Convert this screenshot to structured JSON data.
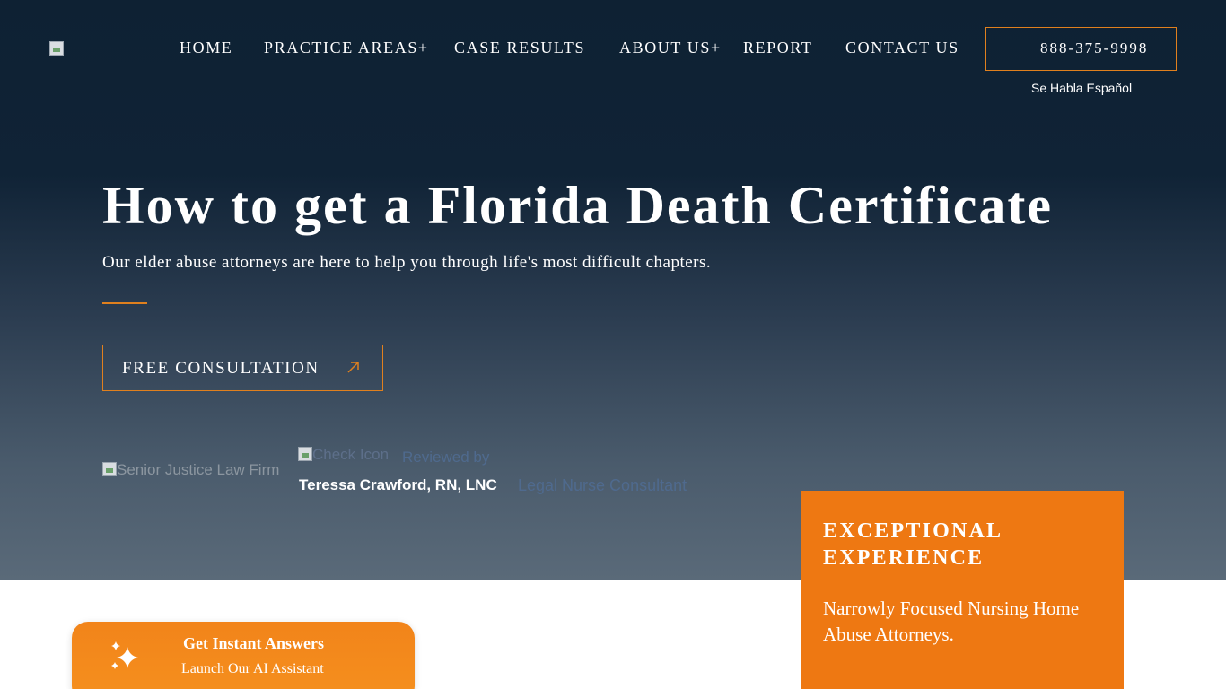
{
  "header": {
    "logo_alt": "",
    "nav": [
      {
        "label": "HOME"
      },
      {
        "label": "PRACTICE AREAS+"
      },
      {
        "label": "CASE RESULTS"
      },
      {
        "label": "ABOUT US+"
      },
      {
        "label": "REPORT"
      },
      {
        "label": "CONTACT US"
      }
    ],
    "phone": "888-375-9998",
    "spanish_note": "Se Habla Español"
  },
  "hero": {
    "title": "How to get a Florida Death Certificate",
    "subtitle": "Our elder abuse attorneys are here to help you through life's most difficult chapters.",
    "cta_label": "FREE CONSULTATION",
    "firm_image_alt": "Senior Justice Law Firm",
    "check_icon_alt": "Check Icon",
    "reviewed_by": "Reviewed by",
    "reviewer_name": "Teressa Crawford, RN, LNC",
    "reviewer_role": "Legal Nurse Consultant"
  },
  "experience_card": {
    "title": "EXCEPTIONAL EXPERIENCE",
    "text": "Narrowly Focused Nursing Home Abuse Attorneys."
  },
  "ai_widget": {
    "title": "Get Instant Answers",
    "subtitle": "Launch Our AI Assistant",
    "icon": "sparkles-icon"
  },
  "colors": {
    "accent": "#ee7812",
    "hero_top": "#0e2133",
    "hero_bottom": "#5a6a79"
  }
}
